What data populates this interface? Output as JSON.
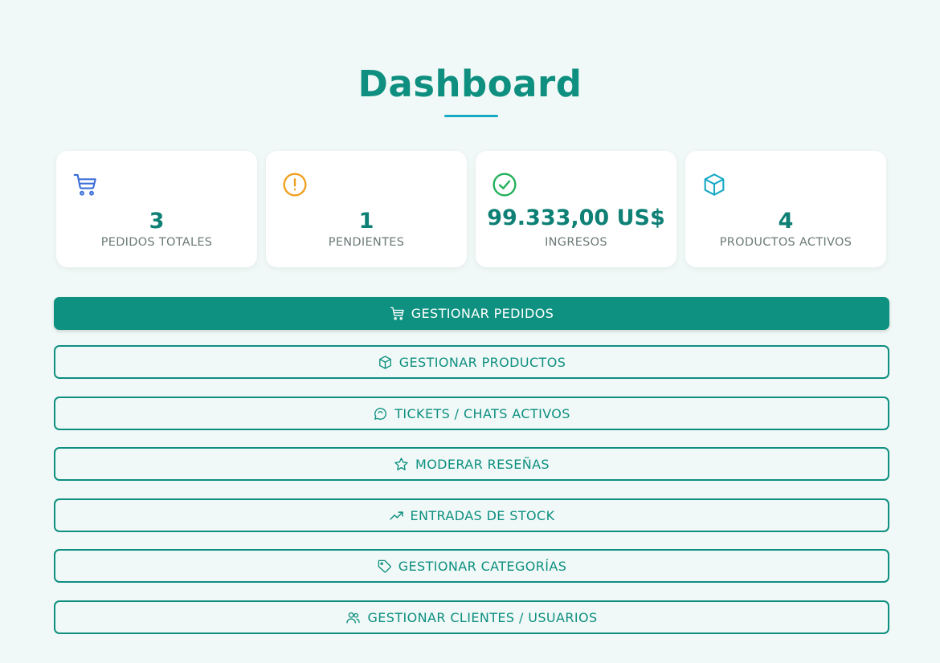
{
  "header": {
    "title": "Dashboard"
  },
  "stats": [
    {
      "icon": "cart-icon",
      "value": "3",
      "label": "PEDIDOS TOTALES",
      "color": "#3b6fd8"
    },
    {
      "icon": "alert-circle-icon",
      "value": "1",
      "label": "PENDIENTES",
      "color": "#f0a020"
    },
    {
      "icon": "check-circle-icon",
      "value": "99.333,00 US$",
      "label": "INGRESOS",
      "color": "#23b05a"
    },
    {
      "icon": "box-icon",
      "value": "4",
      "label": "PRODUCTOS ACTIVOS",
      "color": "#18a9c6"
    }
  ],
  "actions": [
    {
      "icon": "cart-icon",
      "label": "GESTIONAR PEDIDOS",
      "primary": true
    },
    {
      "icon": "box-icon",
      "label": "GESTIONAR PRODUCTOS"
    },
    {
      "icon": "chat-icon",
      "label": "TICKETS / CHATS ACTIVOS"
    },
    {
      "icon": "star-icon",
      "label": "MODERAR RESEÑAS"
    },
    {
      "icon": "trending-up-icon",
      "label": "ENTRADAS DE STOCK"
    },
    {
      "icon": "tag-icon",
      "label": "GESTIONAR CATEGORÍAS"
    },
    {
      "icon": "users-icon",
      "label": "GESTIONAR CLIENTES / USUARIOS"
    }
  ],
  "colors": {
    "accent": "#0e8f80",
    "underline": "#18a9c6",
    "background": "#f0f9f7"
  }
}
